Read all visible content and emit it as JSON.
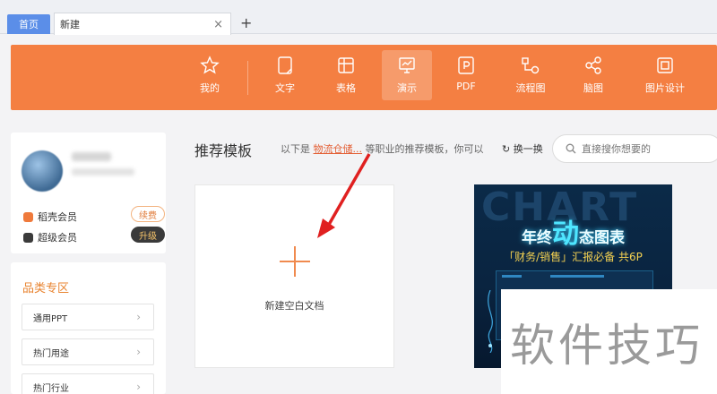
{
  "tabs": {
    "home": "首页",
    "current": "新建",
    "close": "×",
    "add": "+"
  },
  "toolbar": {
    "items": [
      {
        "label": "我的",
        "icon": "star-icon"
      },
      {
        "label": "文字",
        "icon": "document-icon"
      },
      {
        "label": "表格",
        "icon": "spreadsheet-icon"
      },
      {
        "label": "演示",
        "icon": "presentation-icon",
        "active": true
      },
      {
        "label": "PDF",
        "icon": "pdf-icon"
      },
      {
        "label": "流程图",
        "icon": "flowchart-icon"
      },
      {
        "label": "脑图",
        "icon": "mindmap-icon"
      },
      {
        "label": "图片设计",
        "icon": "image-design-icon"
      }
    ],
    "color": "#f47f42"
  },
  "profile": {
    "member1": "稻壳会员",
    "member1_action": "续费",
    "member2": "超级会员",
    "member2_action": "升级"
  },
  "categories": {
    "title": "品类专区",
    "items": [
      "通用PPT",
      "热门用途",
      "热门行业"
    ]
  },
  "main": {
    "title": "推荐模板",
    "rec_prefix": "以下是",
    "rec_link": "物流仓储...",
    "rec_suffix": "等职业的推荐模板，你可以",
    "swap": "换一换",
    "search_placeholder": "直接搜你想要的"
  },
  "blank_card": {
    "label": "新建空白文档"
  },
  "template_card": {
    "ghost_text": "CHART",
    "title_prefix": "年终",
    "title_big": "动",
    "title_suffix": "态图表",
    "subtitle": "「财务/销售」汇报必备  共6P"
  },
  "watermark": "软件技巧"
}
